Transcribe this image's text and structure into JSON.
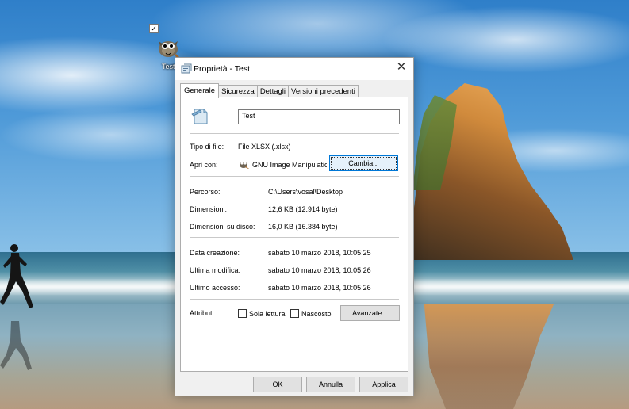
{
  "desktop": {
    "icon_label": "Test",
    "icon_checked": true
  },
  "dialog": {
    "title": "Proprietà - Test",
    "close_glyph": "✕",
    "tabs": [
      {
        "label": "Generale",
        "active": true
      },
      {
        "label": "Sicurezza",
        "active": false
      },
      {
        "label": "Dettagli",
        "active": false
      },
      {
        "label": "Versioni precedenti",
        "active": false
      }
    ],
    "general": {
      "file_name": "Test",
      "file_type_label": "Tipo di file:",
      "file_type_value": "File XLSX (.xlsx)",
      "open_with_label": "Apri con:",
      "open_with_value": "GNU Image Manipulatic",
      "change_button": "Cambia...",
      "location_label": "Percorso:",
      "location_value": "C:\\Users\\vosal\\Desktop",
      "size_label": "Dimensioni:",
      "size_value": "12,6 KB (12.914 byte)",
      "size_on_disk_label": "Dimensioni su disco:",
      "size_on_disk_value": "16,0 KB (16.384 byte)",
      "created_label": "Data creazione:",
      "created_value": "sabato 10 marzo 2018, 10:05:25",
      "modified_label": "Ultima modifica:",
      "modified_value": "sabato 10 marzo 2018, 10:05:26",
      "accessed_label": "Ultimo accesso:",
      "accessed_value": "sabato 10 marzo 2018, 10:05:26",
      "attributes_label": "Attributi:",
      "readonly_label": "Sola lettura",
      "readonly_checked": false,
      "hidden_label": "Nascosto",
      "hidden_checked": false,
      "advanced_button": "Avanzate..."
    },
    "footer": {
      "ok": "OK",
      "cancel": "Annulla",
      "apply": "Applica"
    }
  },
  "colors": {
    "focus_border": "#0078d7",
    "dialog_bg": "#f0f0f0",
    "panel_bg": "#ffffff"
  },
  "icons": [
    "gimp-icon",
    "properties-icon",
    "notepad-file-icon",
    "gimp-small-icon",
    "close-icon",
    "checkbox-icon"
  ]
}
